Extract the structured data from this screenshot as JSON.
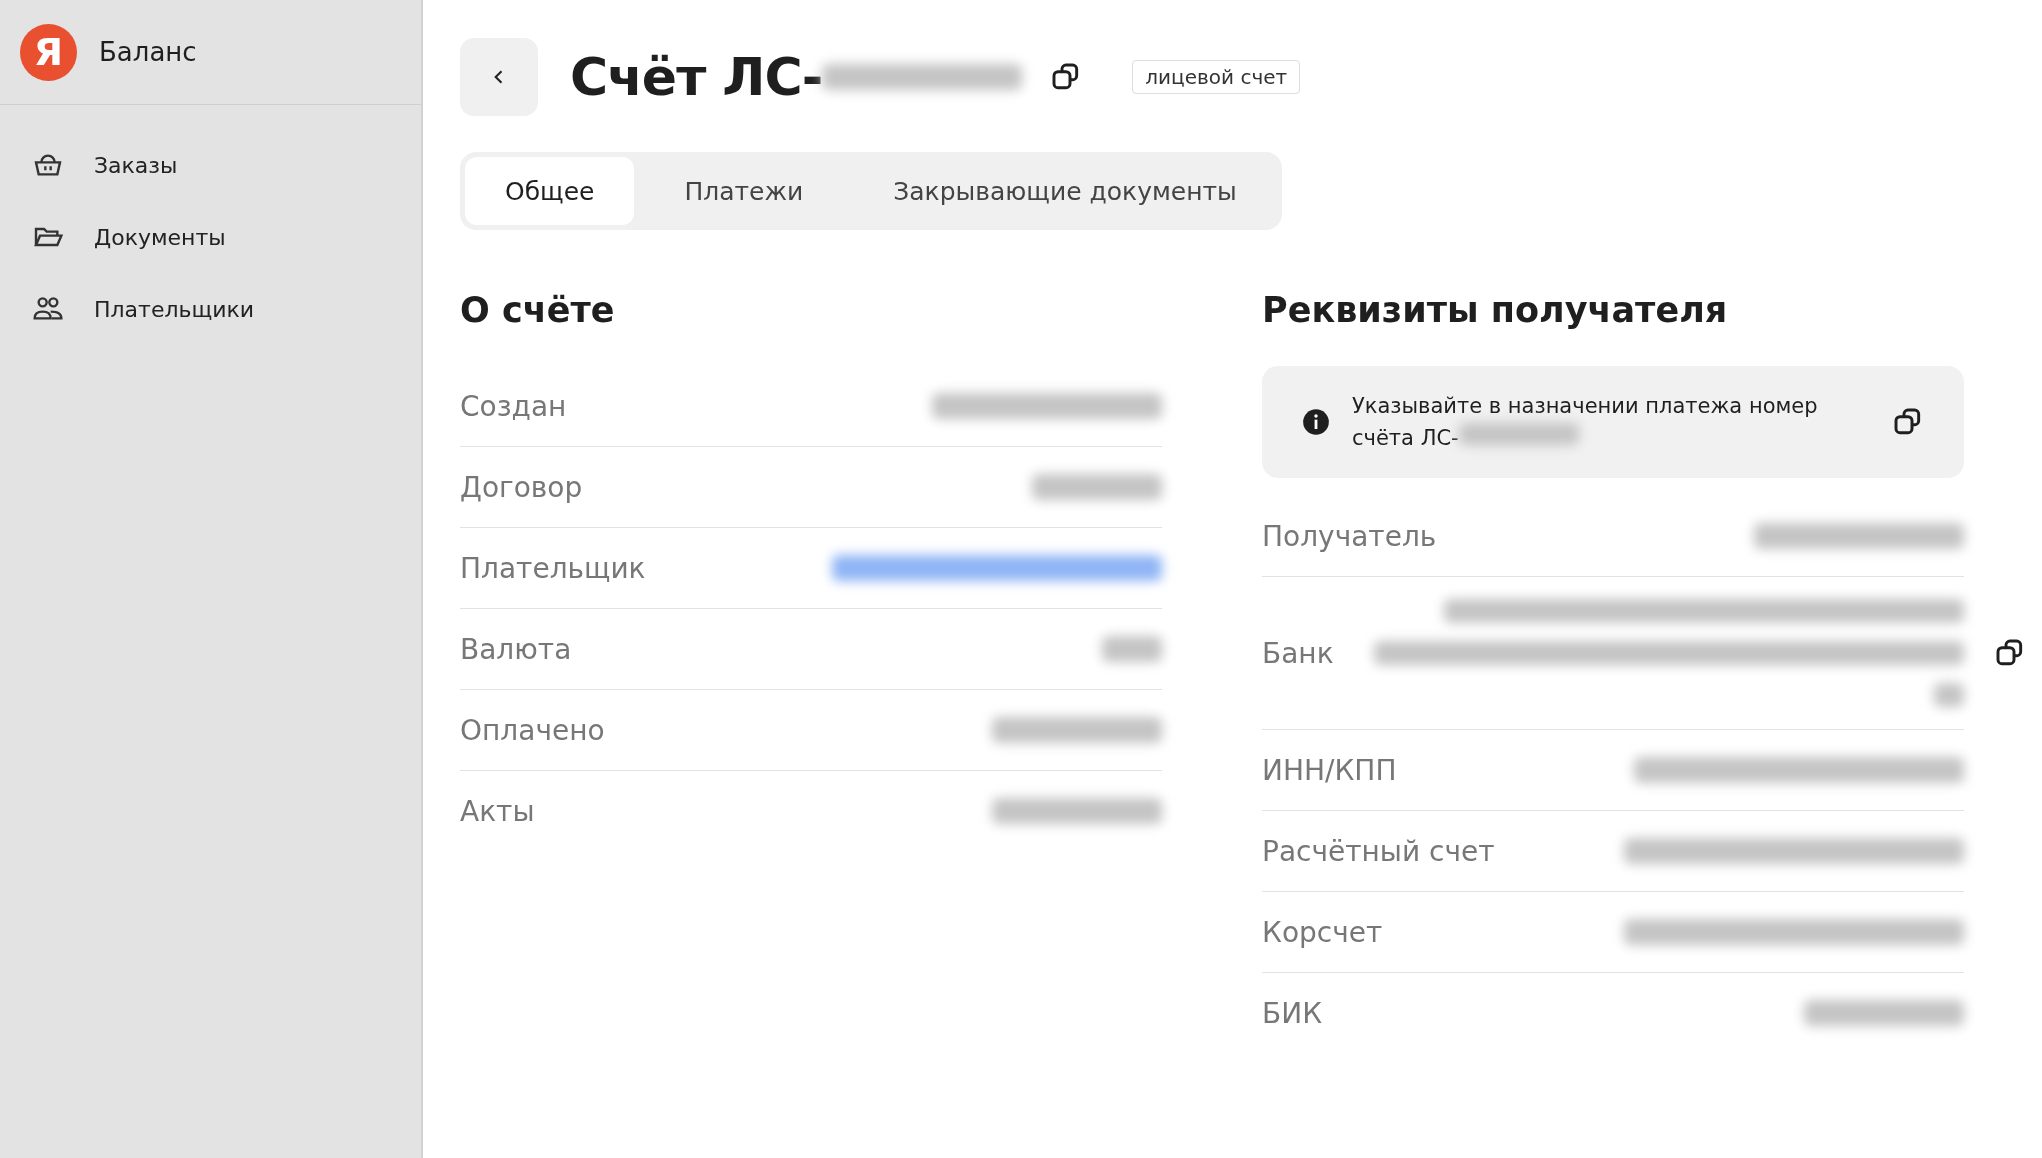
{
  "sidebar": {
    "logo": "Я",
    "title": "Баланс",
    "items": [
      {
        "label": "Заказы",
        "kind": "basket"
      },
      {
        "label": "Документы",
        "kind": "folder"
      },
      {
        "label": "Плательщики",
        "kind": "people"
      }
    ]
  },
  "header": {
    "title": "Счёт ЛС-",
    "title_value": {
      "kind": "redacted"
    },
    "badge": "лицевой счет"
  },
  "tabs": [
    {
      "label": "Общее",
      "selected": true
    },
    {
      "label": "Платежи",
      "selected": false
    },
    {
      "label": "Закрывающие документы",
      "selected": false
    }
  ],
  "account": {
    "title": "О счёте",
    "rows": [
      {
        "label": "Создан",
        "value": {
          "kind": "redacted"
        }
      },
      {
        "label": "Договор",
        "value": {
          "kind": "redacted"
        }
      },
      {
        "label": "Плательщик",
        "value": {
          "kind": "redacted-link"
        }
      },
      {
        "label": "Валюта",
        "value": {
          "kind": "redacted"
        }
      },
      {
        "label": "Оплачено",
        "value": {
          "kind": "redacted"
        }
      },
      {
        "label": "Акты",
        "value": {
          "kind": "redacted"
        }
      }
    ]
  },
  "recipient": {
    "title": "Реквизиты получателя",
    "notice": "Указывайте в назначении платежа номер счёта ЛС-",
    "notice_value": {
      "kind": "redacted"
    },
    "rows": [
      {
        "label": "Получатель",
        "value": {
          "kind": "redacted"
        }
      },
      {
        "label": "Банк",
        "value": {
          "kind": "redacted-multiline"
        },
        "copyable": true
      },
      {
        "label": "ИНН/КПП",
        "value": {
          "kind": "redacted"
        }
      },
      {
        "label": "Расчётный счет",
        "value": {
          "kind": "redacted"
        }
      },
      {
        "label": "Корсчет",
        "value": {
          "kind": "redacted"
        }
      },
      {
        "label": "БИК",
        "value": {
          "kind": "redacted"
        }
      }
    ]
  }
}
